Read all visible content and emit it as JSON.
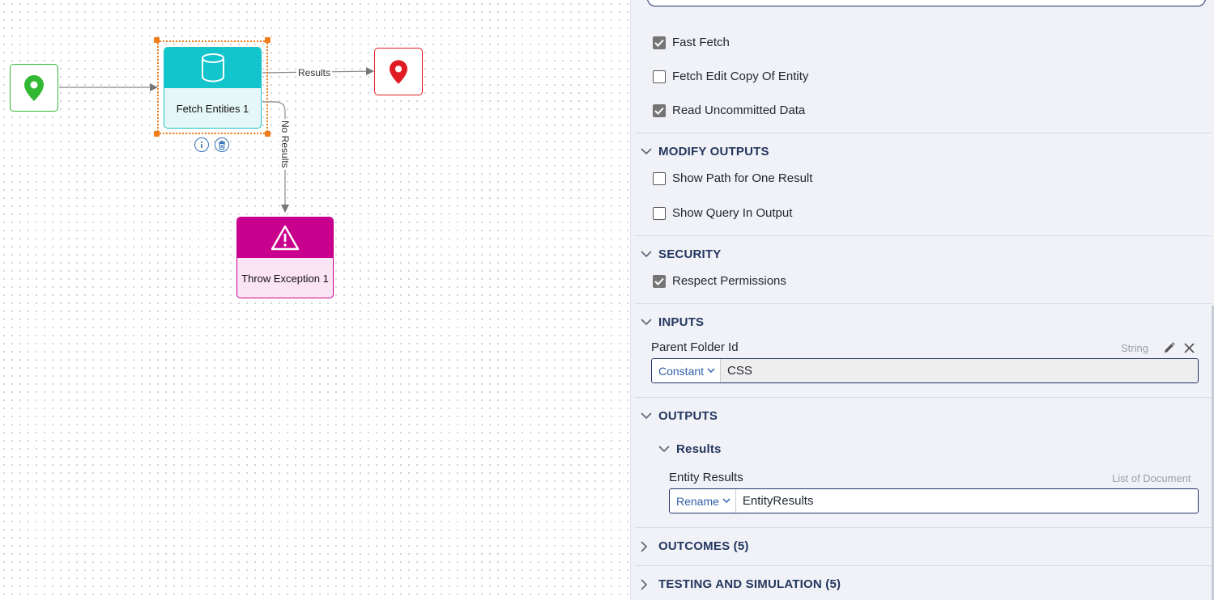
{
  "canvas": {
    "nodes": {
      "start": {
        "icon": "map-pin-icon",
        "color": "#33b833"
      },
      "fetch": {
        "label": "Fetch Entities 1",
        "icon": "database-icon",
        "color": "#12c4cb"
      },
      "end": {
        "icon": "map-pin-icon",
        "color": "#e01b22"
      },
      "throw": {
        "label": "Throw Exception 1",
        "icon": "warning-icon",
        "color": "#c8008d"
      }
    },
    "connectors": {
      "results_label": "Results",
      "no_results_label": "No Results"
    },
    "node_tools": {
      "info_icon": "info-icon",
      "delete_icon": "trash-icon"
    }
  },
  "panel": {
    "options": [
      {
        "label": "Fast Fetch",
        "checked": true
      },
      {
        "label": "Fetch Edit Copy Of Entity",
        "checked": false
      },
      {
        "label": "Read Uncommitted Data",
        "checked": true
      }
    ],
    "sections": {
      "modify_outputs": {
        "title": "MODIFY OUTPUTS",
        "options": [
          {
            "label": "Show Path for One Result",
            "checked": false
          },
          {
            "label": "Show Query In Output",
            "checked": false
          }
        ]
      },
      "security": {
        "title": "SECURITY",
        "options": [
          {
            "label": "Respect Permissions",
            "checked": true
          }
        ]
      },
      "inputs": {
        "title": "INPUTS",
        "field": {
          "label": "Parent Folder Id",
          "type": "String",
          "mode": "Constant",
          "value": "CSS"
        }
      },
      "outputs": {
        "title": "OUTPUTS",
        "subsection": "Results",
        "field": {
          "label": "Entity Results",
          "type": "List of Document",
          "mode": "Rename",
          "value": "EntityResults"
        }
      },
      "outcomes": {
        "title": "OUTCOMES (5)"
      },
      "testing": {
        "title": "TESTING AND SIMULATION (5)"
      }
    },
    "accent_color": "#24365e"
  }
}
